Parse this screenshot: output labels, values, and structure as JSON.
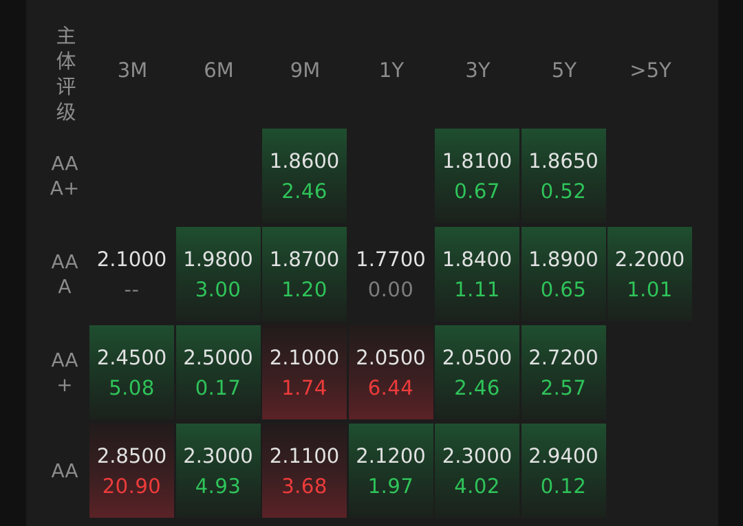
{
  "corner_label": [
    "主",
    "体",
    "评",
    "级"
  ],
  "tenors": [
    "3M",
    "6M",
    "9M",
    "1Y",
    "3Y",
    "5Y",
    ">5Y"
  ],
  "rows": [
    {
      "label": [
        "AA",
        "A+"
      ],
      "cells": [
        null,
        null,
        {
          "price": "1.8600",
          "change": "2.46",
          "tone": "up",
          "bg": "green"
        },
        null,
        {
          "price": "1.8100",
          "change": "0.67",
          "tone": "up",
          "bg": "green"
        },
        {
          "price": "1.8650",
          "change": "0.52",
          "tone": "up",
          "bg": "green"
        },
        null
      ]
    },
    {
      "label": [
        "AA",
        "A"
      ],
      "cells": [
        {
          "price": "2.1000",
          "change": "--",
          "tone": "flat",
          "bg": "none"
        },
        {
          "price": "1.9800",
          "change": "3.00",
          "tone": "up",
          "bg": "green"
        },
        {
          "price": "1.8700",
          "change": "1.20",
          "tone": "up",
          "bg": "green"
        },
        {
          "price": "1.7700",
          "change": "0.00",
          "tone": "flat",
          "bg": "none"
        },
        {
          "price": "1.8400",
          "change": "1.11",
          "tone": "up",
          "bg": "green"
        },
        {
          "price": "1.8900",
          "change": "0.65",
          "tone": "up",
          "bg": "green"
        },
        {
          "price": "2.2000",
          "change": "1.01",
          "tone": "up",
          "bg": "green"
        }
      ]
    },
    {
      "label": [
        "AA",
        "+"
      ],
      "cells": [
        {
          "price": "2.4500",
          "change": "5.08",
          "tone": "up",
          "bg": "green"
        },
        {
          "price": "2.5000",
          "change": "0.17",
          "tone": "up",
          "bg": "green"
        },
        {
          "price": "2.1000",
          "change": "1.74",
          "tone": "down",
          "bg": "red"
        },
        {
          "price": "2.0500",
          "change": "6.44",
          "tone": "down",
          "bg": "red"
        },
        {
          "price": "2.0500",
          "change": "2.46",
          "tone": "up",
          "bg": "green"
        },
        {
          "price": "2.7200",
          "change": "2.57",
          "tone": "up",
          "bg": "green"
        },
        null
      ]
    },
    {
      "label": [
        "AA"
      ],
      "cells": [
        {
          "price": "2.8500",
          "change": "20.90",
          "tone": "down",
          "bg": "red"
        },
        {
          "price": "2.3000",
          "change": "4.93",
          "tone": "up",
          "bg": "green"
        },
        {
          "price": "2.1100",
          "change": "3.68",
          "tone": "down",
          "bg": "red"
        },
        {
          "price": "2.1200",
          "change": "1.97",
          "tone": "up",
          "bg": "green"
        },
        {
          "price": "2.3000",
          "change": "4.02",
          "tone": "up",
          "bg": "green"
        },
        {
          "price": "2.9400",
          "change": "0.12",
          "tone": "up",
          "bg": "green"
        },
        null
      ]
    }
  ],
  "colors": {
    "up": "#2fc45a",
    "down": "#ee3b3b",
    "flat": "#7d7d7d",
    "background": "#1c1c1c"
  }
}
